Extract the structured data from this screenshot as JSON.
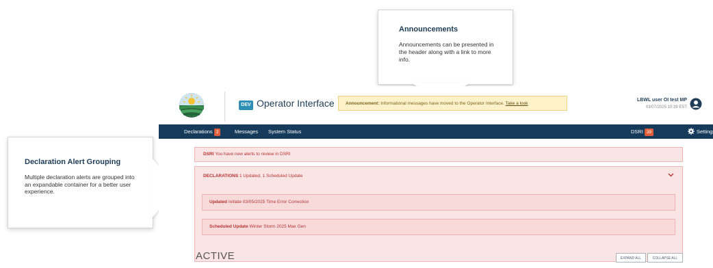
{
  "callouts": {
    "announcements": {
      "title": "Announcements",
      "body": "Announcements can be presented in the header along with a link to more info."
    },
    "grouping": {
      "title": "Declaration Alert Grouping",
      "body": "Multiple declaration alerts are grouped into an expandable container for a better user experience."
    }
  },
  "header": {
    "env_badge": "DEV",
    "app_title": "Operator Interface",
    "announcement": {
      "label": "Announcement:",
      "message": "Informational messages have moved to the Operator Interface.",
      "link": "Take a look"
    },
    "user": {
      "name": "LBWL user OI test MP",
      "timestamp": "03/07/2025 10:39 EST"
    }
  },
  "nav": {
    "declarations": {
      "label": "Declarations",
      "badge": "2"
    },
    "messages": {
      "label": "Messages"
    },
    "system_status": {
      "label": "System Status"
    },
    "dsri": {
      "label": "DSRI",
      "badge": "39"
    },
    "settings": {
      "label": "Settings"
    }
  },
  "alerts": {
    "dsri": {
      "label": "DSRI",
      "message": "You have new alerts to review in DSRI"
    },
    "declarations": {
      "label": "DECLARATIONS",
      "summary": "1 Updated, 1 Scheduled Update",
      "items": [
        {
          "status": "Updated",
          "text": "Initiate 03/05/2025 Time Error Correction"
        },
        {
          "status": "Scheduled Update",
          "text": "Winter Storm 2025 Max Gen"
        }
      ]
    }
  },
  "active": {
    "heading": "ACTIVE",
    "expand_all": "EXPAND ALL",
    "collapse_all": "COLLAPSE ALL"
  },
  "colors": {
    "nav_bg": "#163a5a",
    "alert_bg": "#fbe4e4",
    "alert_text": "#b23333",
    "announcement_bg": "#fdf1c9",
    "badge": "#e05e3a"
  }
}
